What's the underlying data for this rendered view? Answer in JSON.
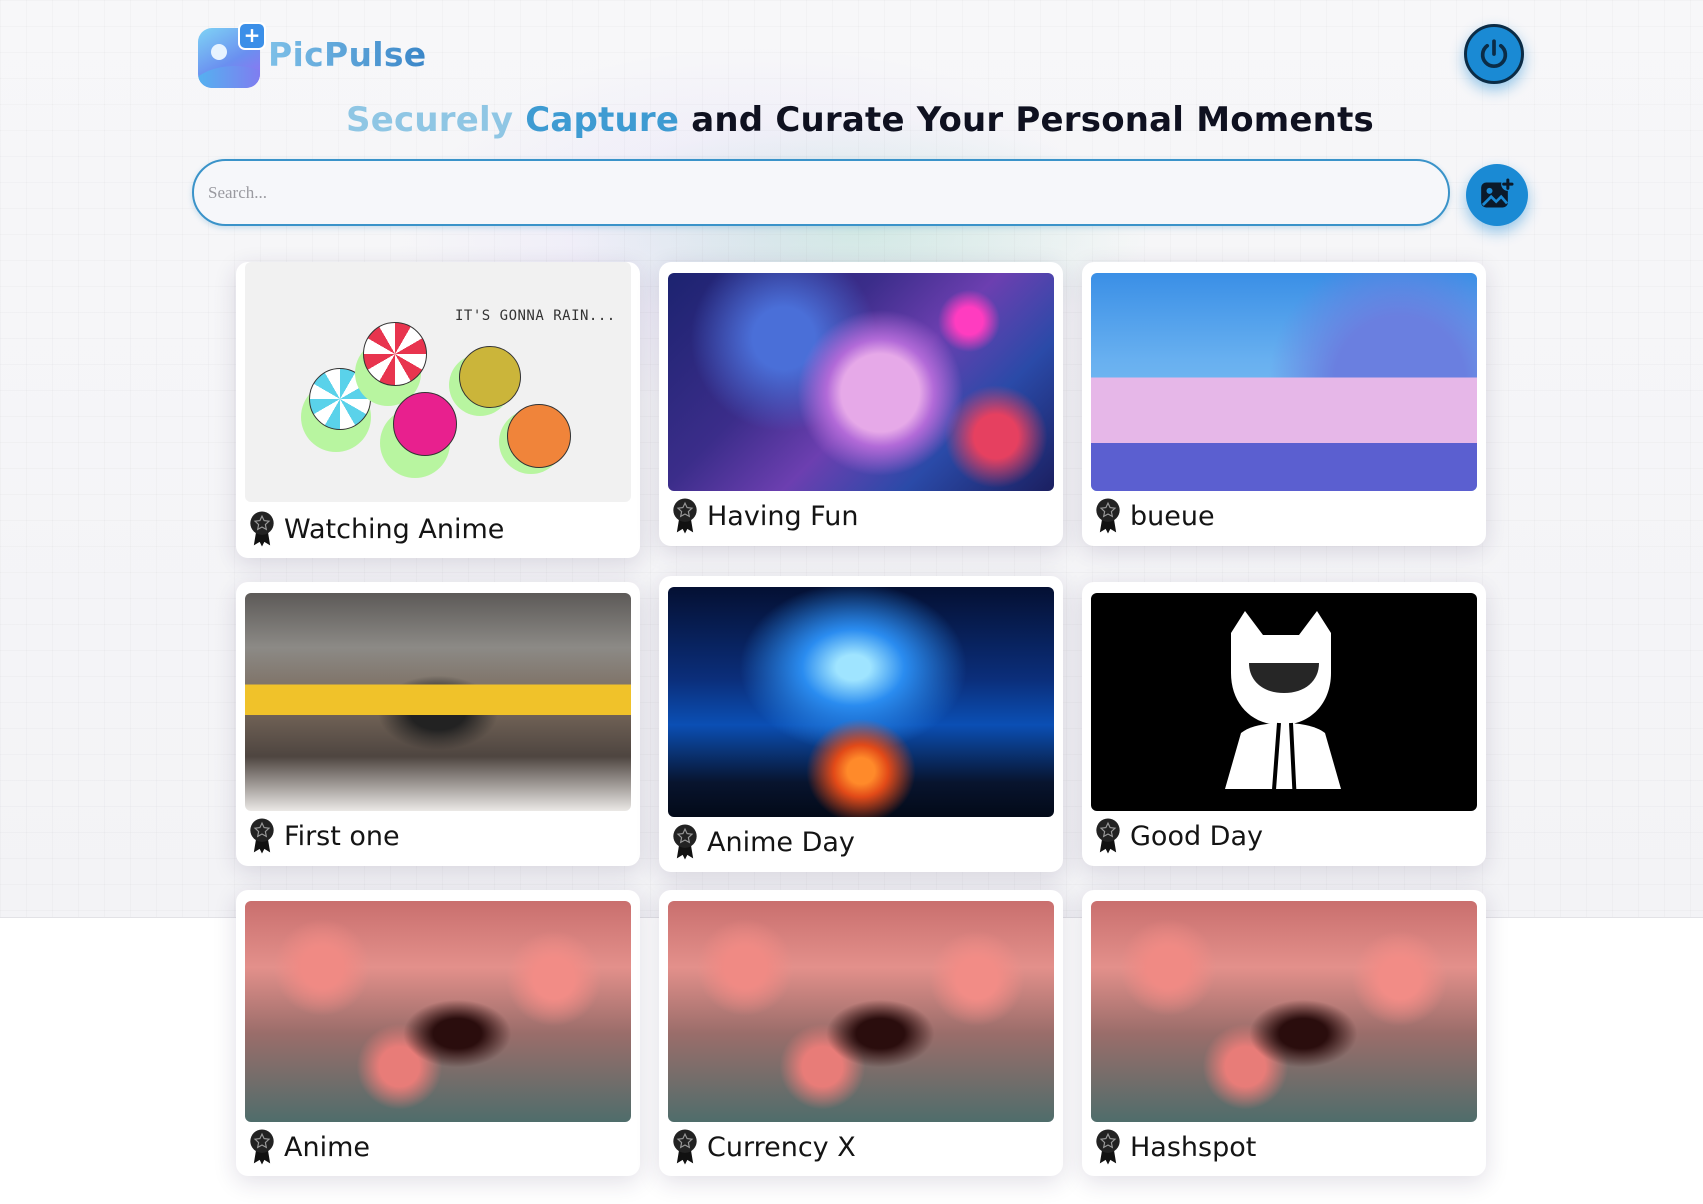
{
  "header": {
    "logo_text": "PicPulse",
    "headline": {
      "part1": "Securely",
      "part2": "Capture",
      "part3": "and Curate Your Personal Moments"
    },
    "logout_icon": "power-icon"
  },
  "search": {
    "placeholder": "Search...",
    "value": "",
    "upload_icon": "add-image-icon"
  },
  "gallery": {
    "badge_icon": "award-ribbon-icon",
    "cards": [
      {
        "title": "Watching Anime",
        "image_text": "IT'S GONNA RAIN..."
      },
      {
        "title": "Having Fun"
      },
      {
        "title": "bueue"
      },
      {
        "title": "First one"
      },
      {
        "title": "Anime Day"
      },
      {
        "title": "Good Day"
      },
      {
        "title": "Anime"
      },
      {
        "title": "Currency X"
      },
      {
        "title": "Hashspot"
      }
    ]
  },
  "colors": {
    "accent": "#1a8ad4",
    "search_border": "#3a93c9",
    "headline_light": "#8fc6e4",
    "headline_mid": "#3e9bd2",
    "headline_dark": "#0f1120"
  }
}
